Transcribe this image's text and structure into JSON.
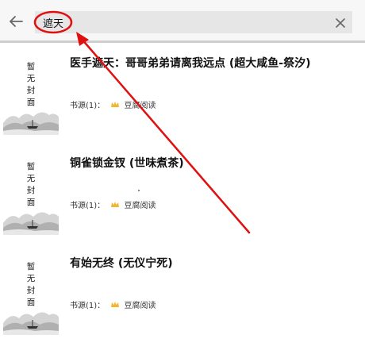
{
  "search": {
    "value": "遮天"
  },
  "results": [
    {
      "title": "医手遮天：哥哥弟弟请离我远点 (超大咸鱼-祭汐)",
      "cover_text": [
        "暂",
        "无",
        "封",
        "面"
      ],
      "source_label": "书源(1)：",
      "source_name": "豆腐阅读"
    },
    {
      "title": "铜雀锁金钗 (世味煮茶)",
      "cover_text": [
        "暂",
        "无",
        "封",
        "面"
      ],
      "source_label": "书源(1)：",
      "source_name": "豆腐阅读"
    },
    {
      "title": "有始无终 (无仪宁死)",
      "cover_text": [
        "暂",
        "无",
        "封",
        "面"
      ],
      "source_label": "书源(1)：",
      "source_name": "豆腐阅读"
    }
  ],
  "colors": {
    "annotation": "#e01010",
    "source_icon": "#f2b72e",
    "topbar_bg": "#f7f7f7",
    "search_bg": "#e6e6e6"
  },
  "icons": {
    "back": "arrow-left-icon",
    "clear": "close-icon",
    "source": "crown-icon"
  }
}
